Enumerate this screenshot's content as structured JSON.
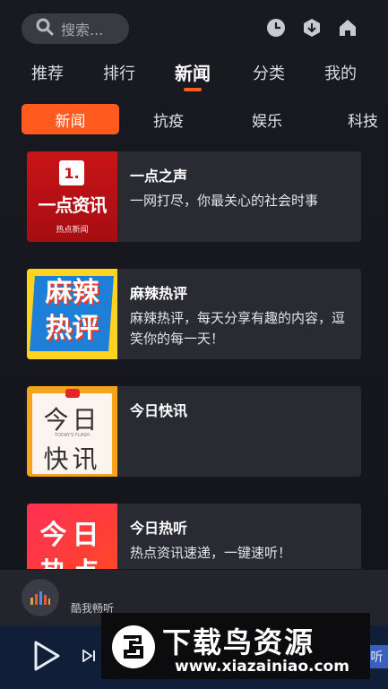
{
  "search": {
    "placeholder": "搜索..."
  },
  "main_tabs": [
    "推荐",
    "排行",
    "新闻",
    "分类",
    "我的"
  ],
  "sub_tabs": [
    "新闻",
    "抗疫",
    "娱乐",
    "科技"
  ],
  "cards": [
    {
      "title": "一点之声",
      "desc": "一网打尽，你最关心的社会时事",
      "thumb": {
        "line1": "1.",
        "line2": "一点资讯",
        "line3": "热点新闻"
      }
    },
    {
      "title": "麻辣热评",
      "desc": "麻辣热评，每天分享有趣的内容，逗笑你的每一天！",
      "thumb": {
        "line1": "麻辣",
        "line2": "热评"
      }
    },
    {
      "title": "今日快讯",
      "desc": "",
      "thumb": {
        "line1": "今日",
        "line2": "TODAY'S FLASH",
        "line3": "快讯"
      }
    },
    {
      "title": "今日热听",
      "desc": "热点资讯速递，一键速听！",
      "thumb": {
        "line1": "今日",
        "line2": "热点"
      }
    }
  ],
  "mini_player": {
    "name": "酷我畅听"
  },
  "watermark": {
    "title": "下载鸟资源",
    "url": "www.xiazainiao.com"
  },
  "player": {
    "side_label": "听"
  },
  "colors": {
    "accent": "#ff5a1f",
    "card_bg": "#2a2b32",
    "player_bg": "#101e3a"
  }
}
